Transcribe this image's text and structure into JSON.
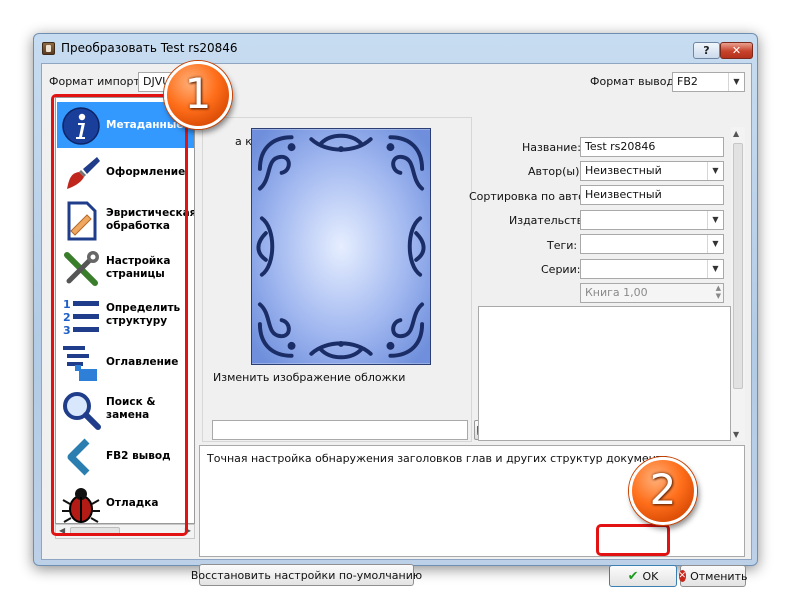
{
  "window": {
    "title": "Преобразовать Test rs20846",
    "help_label": "?",
    "close_label": "✕"
  },
  "top": {
    "import_label": "Формат импорта:",
    "import_value": "DJVU",
    "output_label": "Формат вывода:",
    "output_value": "FB2"
  },
  "sidebar": {
    "items": [
      {
        "label": "Метаданные",
        "icon": "info-icon"
      },
      {
        "label": "Оформление",
        "icon": "paint-brush-icon"
      },
      {
        "label": "Эвристическая\nобработка",
        "icon": "document-patch-icon"
      },
      {
        "label": "Настройка страницы",
        "icon": "wrench-screwdriver-icon"
      },
      {
        "label": "Определить\nструктуру",
        "icon": "numbered-list-icon"
      },
      {
        "label": "Оглавление",
        "icon": "toc-hand-icon"
      },
      {
        "label": "Поиск &\nзамена",
        "icon": "magnifier-icon"
      },
      {
        "label": "FB2 вывод",
        "icon": "chevron-left-icon"
      },
      {
        "label": "Отладка",
        "icon": "bug-icon"
      }
    ]
  },
  "cover": {
    "group_title": "а книги",
    "change_label": "Изменить изображение обложки",
    "path_value": ""
  },
  "meta": {
    "title_label": "Название:",
    "title_value": "Test rs20846",
    "author_label": "Автор(ы)",
    "author_value": "Неизвестный",
    "sort_label": "Сортировка по автору",
    "sort_value": "Неизвестный",
    "publisher_label": "Издательство:",
    "publisher_value": "",
    "tags_label": "Теги:",
    "tags_value": "",
    "series_label": "Серии:",
    "series_value": "",
    "book_num": "Книга 1,00"
  },
  "description": "Точная настройка обнаружения заголовков глав и других структур документа.",
  "buttons": {
    "restore": "Восстановить настройки по-умолчанию",
    "ok": "OK",
    "cancel": "Отменить"
  },
  "annotations": {
    "badge1": "1",
    "badge2": "2"
  },
  "colors": {
    "selection": "#3399ff",
    "highlight": "#e21212",
    "badge": "#ff6f1b"
  }
}
